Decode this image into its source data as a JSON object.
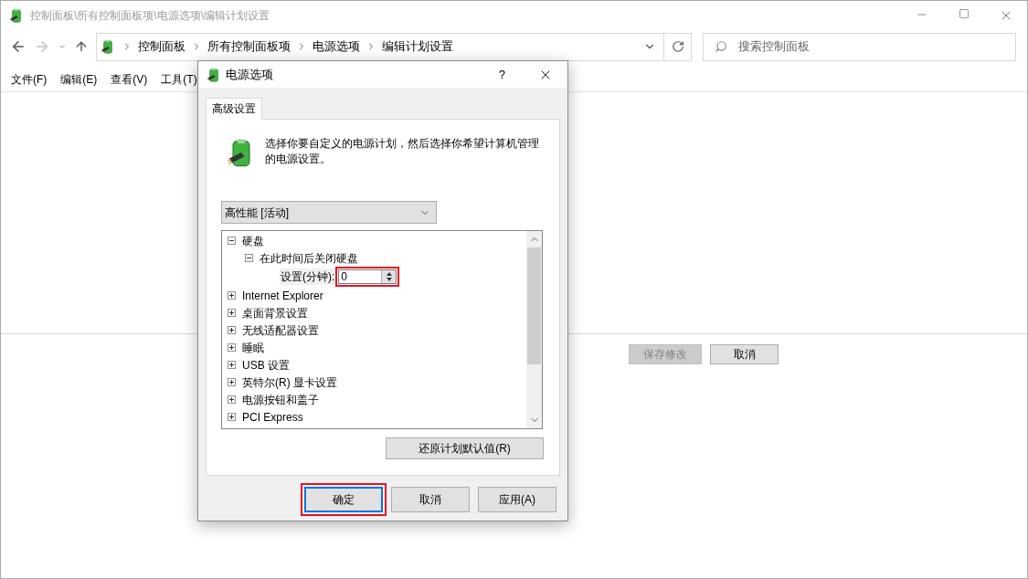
{
  "window": {
    "title": "控制面板\\所有控制面板项\\电源选项\\编辑计划设置"
  },
  "address_bar": {
    "crumbs": [
      "控制面板",
      "所有控制面板项",
      "电源选项",
      "编辑计划设置"
    ]
  },
  "search": {
    "placeholder": "搜索控制面板"
  },
  "menu": [
    "文件(F)",
    "编辑(E)",
    "查看(V)",
    "工具(T)"
  ],
  "footer_buttons": [
    {
      "label": "保存修改",
      "disabled": true
    },
    {
      "label": "取消",
      "disabled": false
    }
  ],
  "dialog": {
    "title": "电源选项",
    "help": "?",
    "tabs": [
      {
        "label": "高级设置",
        "selected": true
      }
    ],
    "description": "选择你要自定义的电源计划，然后选择你希望计算机管理的电源设置。",
    "plan": "高性能 [活动]",
    "tree": [
      {
        "label": "硬盘",
        "expanded": true,
        "children": [
          {
            "label": "在此时间后关闭硬盘",
            "expanded": true,
            "children": [
              {
                "kind": "setting",
                "label": "设置(分钟):",
                "value": "0",
                "highlighted": true
              }
            ]
          }
        ]
      },
      {
        "label": "Internet Explorer",
        "expanded": false
      },
      {
        "label": "桌面背景设置",
        "expanded": false
      },
      {
        "label": "无线适配器设置",
        "expanded": false
      },
      {
        "label": "睡眠",
        "expanded": false
      },
      {
        "label": "USB 设置",
        "expanded": false
      },
      {
        "label": "英特尔(R) 显卡设置",
        "expanded": false
      },
      {
        "label": "电源按钮和盖子",
        "expanded": false
      },
      {
        "label": "PCI Express",
        "expanded": false
      }
    ],
    "restore_button": "还原计划默认值(R)",
    "buttons": [
      {
        "label": "确定",
        "default": true,
        "highlighted": true
      },
      {
        "label": "取消",
        "default": false,
        "highlighted": false
      },
      {
        "label": "应用(A)",
        "default": false,
        "highlighted": false
      }
    ]
  }
}
